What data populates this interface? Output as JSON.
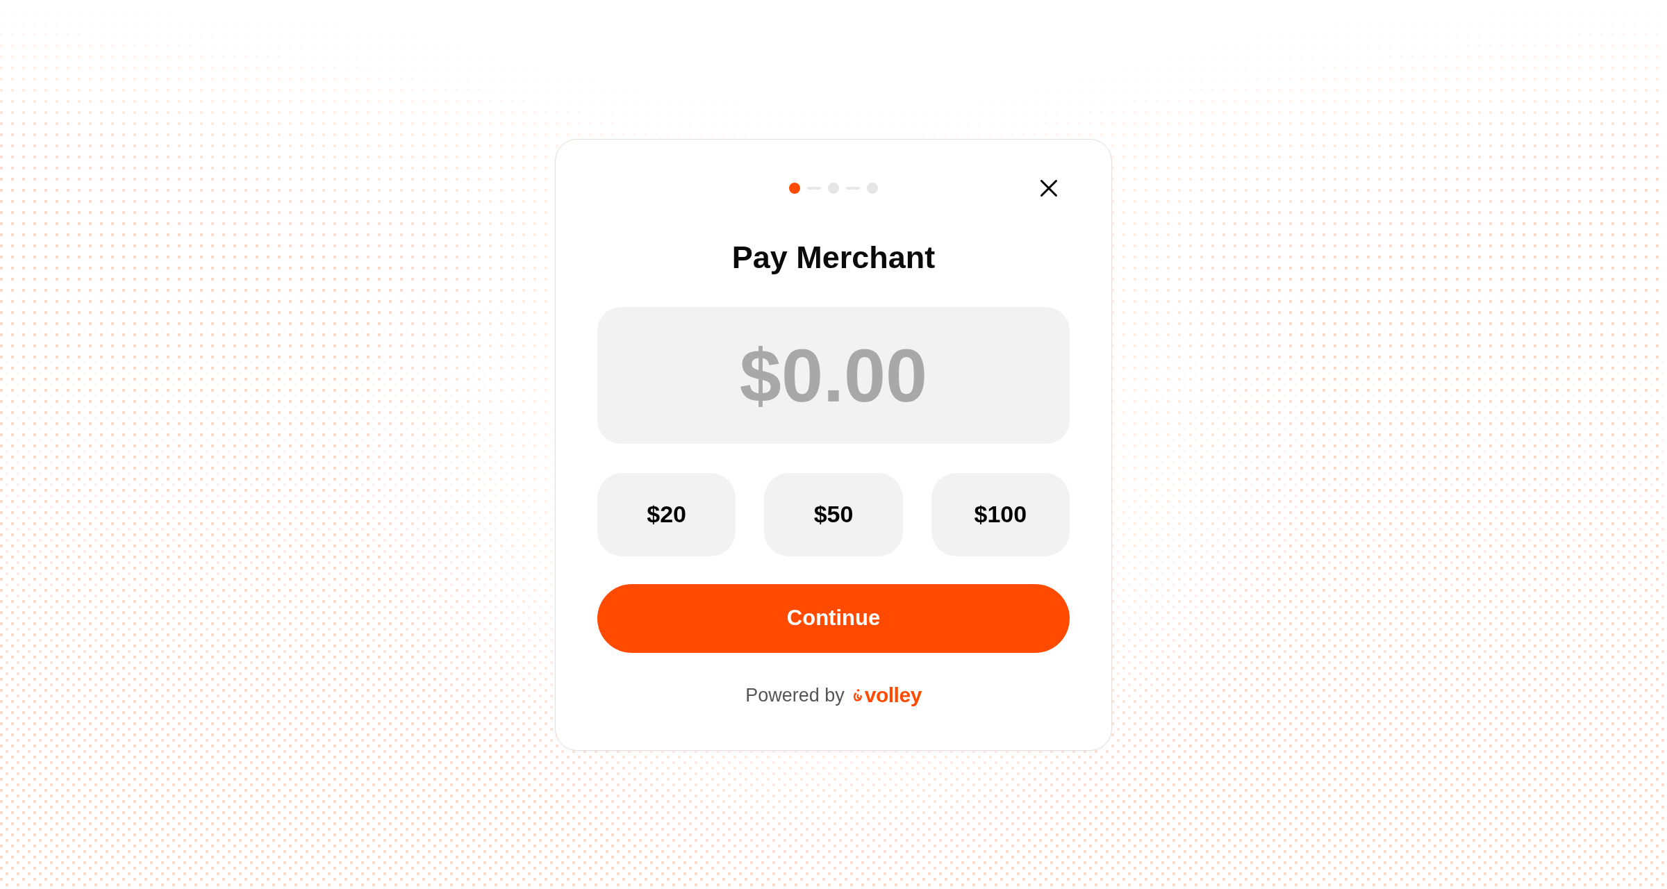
{
  "dialog": {
    "steps": [
      {
        "selected": true
      },
      {
        "selected": false
      },
      {
        "selected": false
      }
    ],
    "title": "Pay Merchant",
    "amount_field": {
      "placeholder": "$0.00"
    },
    "quick_amounts": [
      {
        "label": "$20"
      },
      {
        "label": "$50"
      },
      {
        "label": "$100"
      }
    ],
    "continue_button": {
      "label": "Continue"
    },
    "footer": {
      "text": "Powered by",
      "brand": "volley"
    }
  }
}
